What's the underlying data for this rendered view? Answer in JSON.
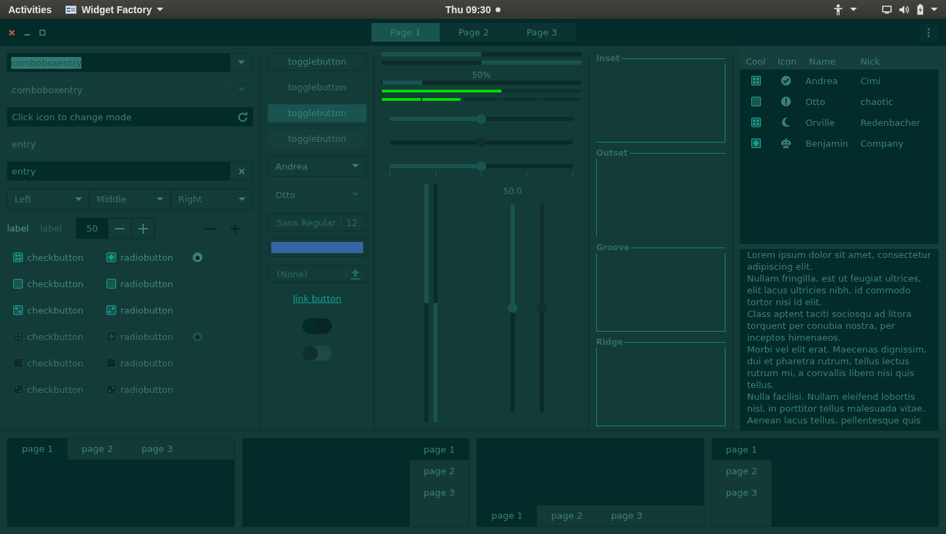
{
  "top_bar": {
    "activities": "Activities",
    "app_menu": "Widget Factory",
    "clock": "Thu 09:30"
  },
  "window": {
    "tabs": [
      {
        "label": "Page 1",
        "selected": true
      },
      {
        "label": "Page 2",
        "selected": false
      },
      {
        "label": "Page 3",
        "selected": false
      }
    ]
  },
  "entries": [
    {
      "kind": "combo",
      "value": "comboboxentry",
      "text_selected": true,
      "disabled": false
    },
    {
      "kind": "combo",
      "value": "comboboxentry",
      "text_selected": false,
      "disabled": true
    },
    {
      "kind": "refresh",
      "value": "Click icon to change mode",
      "text_selected": false,
      "disabled": false
    },
    {
      "kind": "plain",
      "value": "entry",
      "text_selected": false,
      "disabled": true
    },
    {
      "kind": "clear",
      "value": "entry",
      "text_selected": false,
      "disabled": false
    }
  ],
  "linked_combos": [
    {
      "label": "Left"
    },
    {
      "label": "Middle"
    },
    {
      "label": "Right"
    }
  ],
  "labels": [
    {
      "text": "label",
      "disabled": false
    },
    {
      "text": "label",
      "disabled": true
    }
  ],
  "spin_buttons": [
    {
      "value": "50",
      "disabled": false
    },
    {
      "disabled": true
    }
  ],
  "check_rows": [
    {
      "disabled": false,
      "check": {
        "label": "checkbutton",
        "checked": true,
        "inconsistent": false
      },
      "radio": {
        "label": "radiobutton",
        "checked": true,
        "inconsistent": false
      },
      "bare_radio": {
        "checked": true
      }
    },
    {
      "disabled": false,
      "check": {
        "label": "checkbutton",
        "checked": false,
        "inconsistent": false
      },
      "radio": {
        "label": "radiobutton",
        "checked": false,
        "inconsistent": false
      }
    },
    {
      "disabled": false,
      "check": {
        "label": "checkbutton",
        "checked": false,
        "inconsistent": true
      },
      "radio": {
        "label": "radiobutton",
        "checked": false,
        "inconsistent": true
      }
    },
    {
      "disabled": true,
      "check": {
        "label": "checkbutton",
        "checked": true,
        "inconsistent": false
      },
      "radio": {
        "label": "radiobutton",
        "checked": true,
        "inconsistent": false
      },
      "bare_radio": {
        "checked": true
      }
    },
    {
      "disabled": true,
      "check": {
        "label": "checkbutton",
        "checked": false,
        "inconsistent": false
      },
      "radio": {
        "label": "radiobutton",
        "checked": false,
        "inconsistent": false
      }
    },
    {
      "disabled": true,
      "check": {
        "label": "checkbutton",
        "checked": false,
        "inconsistent": true
      },
      "radio": {
        "label": "radiobutton",
        "checked": false,
        "inconsistent": true
      }
    }
  ],
  "toggle_buttons": [
    {
      "label": "togglebutton",
      "active": false,
      "disabled": false
    },
    {
      "label": "togglebutton",
      "active": false,
      "disabled": true
    },
    {
      "label": "togglebutton",
      "active": true,
      "disabled": false
    },
    {
      "label": "togglebutton",
      "active": true,
      "disabled": true
    }
  ],
  "combos": [
    {
      "value": "Andrea",
      "disabled": false
    },
    {
      "value": "Otto",
      "disabled": true
    }
  ],
  "font_button": {
    "family": "Sans Regular",
    "size": "12"
  },
  "color_button": {
    "color": "#3465a4"
  },
  "file_button": {
    "value": "(None)"
  },
  "link_button": {
    "label": "link button"
  },
  "switches": [
    {
      "on": false,
      "disabled": false
    },
    {
      "on": false,
      "disabled": true
    }
  ],
  "progress_bars": [
    {
      "level": 0.5,
      "inverted": false
    },
    {
      "level": 0.5,
      "inverted": true
    },
    {
      "level": 0.2,
      "inverted": false,
      "text": "50%"
    }
  ],
  "level_bars": [
    {
      "kind": "continuous",
      "level": 0.6
    },
    {
      "kind": "discrete",
      "level": 0.4
    }
  ],
  "scales": [
    {
      "level": 0.5,
      "disabled": false,
      "marks": false
    },
    {
      "level": 0.5,
      "disabled": true,
      "marks": false
    },
    {
      "level": 0.5,
      "disabled": false,
      "marks": true
    }
  ],
  "vertical_progress": [
    {
      "level": 0.5,
      "inverted": false
    },
    {
      "level": 0.5,
      "inverted": true
    }
  ],
  "vertical_scales": [
    {
      "level": 0.5,
      "disabled": false,
      "value": "50.0"
    },
    {
      "level": 0.5,
      "disabled": true
    }
  ],
  "frames": [
    {
      "kind": "inset",
      "label": "Inset"
    },
    {
      "kind": "outset",
      "label": "Outset"
    },
    {
      "kind": "groove",
      "label": "Groove"
    },
    {
      "kind": "ridge",
      "label": "Ridge"
    }
  ],
  "tree": {
    "columns": [
      "Cool",
      "Icon",
      "Name",
      "Nick"
    ],
    "rows": [
      {
        "cool": true,
        "inconsistent": false,
        "name": "Andrea",
        "nick": "Cimi"
      },
      {
        "cool": false,
        "inconsistent": false,
        "name": "Otto",
        "nick": "chaotic"
      },
      {
        "cool": true,
        "inconsistent": false,
        "name": "Orville",
        "nick": "Redenbacher"
      },
      {
        "cool": false,
        "inconsistent": true,
        "name": "Benjamin",
        "nick": "Company"
      }
    ]
  },
  "text_view": {
    "paragraphs": [
      "Lorem ipsum dolor sit amet, consectetur adipiscing elit.",
      "Nullam fringilla, est ut feugiat ultrices, elit lacus ultricies nibh, id commodo tortor nisi id elit.",
      "Class aptent taciti sociosqu ad litora torquent per conubia nostra, per inceptos himenaeos.",
      "Morbi vel elit erat. Maecenas dignissim, dui et pharetra rutrum, tellus lectus rutrum mi, a convallis libero nisi quis tellus.",
      "Nulla facilisi. Nullam eleifend lobortis nisl, in porttitor tellus malesuada vitae.",
      "Aenean lacus tellus, pellentesque quis"
    ]
  },
  "notebooks": [
    {
      "kind": "top",
      "tabs": [
        {
          "label": "page 1",
          "selected": true
        },
        {
          "label": "page 2",
          "selected": false
        },
        {
          "label": "page 3",
          "selected": false
        }
      ]
    },
    {
      "kind": "right",
      "tabs": [
        {
          "label": "page 1",
          "selected": true
        },
        {
          "label": "page 2",
          "selected": false
        },
        {
          "label": "page 3",
          "selected": false
        }
      ]
    },
    {
      "kind": "bottom",
      "tabs": [
        {
          "label": "page 1",
          "selected": true
        },
        {
          "label": "page 2",
          "selected": false
        },
        {
          "label": "page 3",
          "selected": false
        }
      ]
    },
    {
      "kind": "left",
      "tabs": [
        {
          "label": "page 1",
          "selected": true
        },
        {
          "label": "page 2",
          "selected": false
        },
        {
          "label": "page 3",
          "selected": false
        }
      ]
    }
  ]
}
